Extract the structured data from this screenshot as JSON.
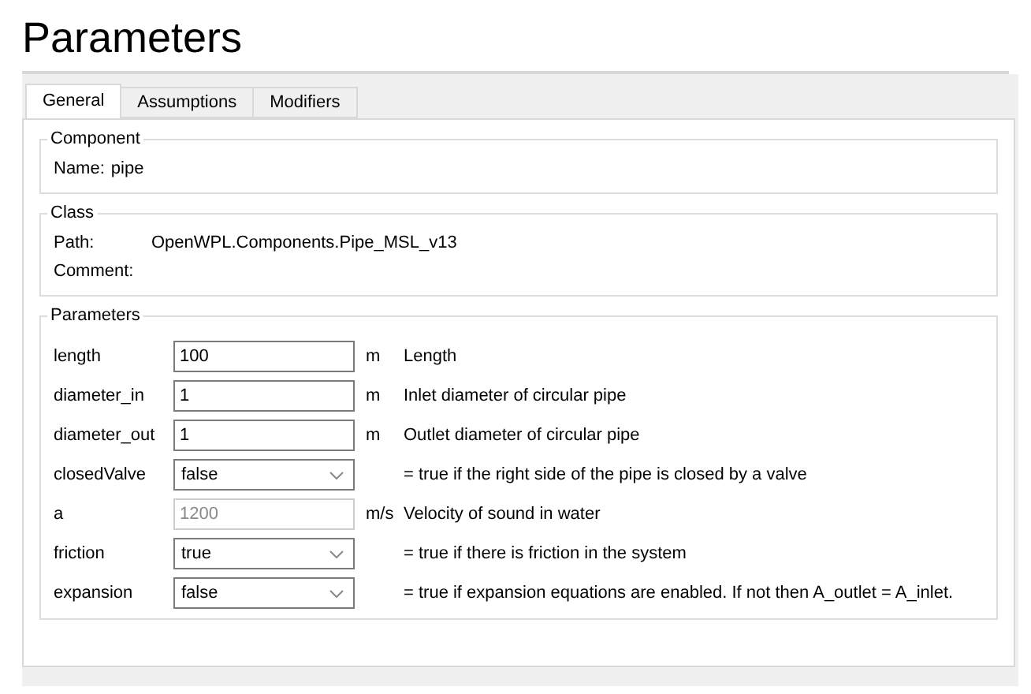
{
  "title": "Parameters",
  "tabs": [
    {
      "label": "General",
      "selected": true
    },
    {
      "label": "Assumptions",
      "selected": false
    },
    {
      "label": "Modifiers",
      "selected": false
    }
  ],
  "component": {
    "legend": "Component",
    "name_label": "Name:",
    "name_value": "pipe"
  },
  "class": {
    "legend": "Class",
    "path_label": "Path:",
    "path_value": "OpenWPL.Components.Pipe_MSL_v13",
    "comment_label": "Comment:"
  },
  "parameters": {
    "legend": "Parameters",
    "rows": [
      {
        "name": "length",
        "kind": "input",
        "value": "100",
        "unit": "m",
        "description": "Length"
      },
      {
        "name": "diameter_in",
        "kind": "input",
        "value": "1",
        "unit": "m",
        "description": "Inlet diameter of circular pipe"
      },
      {
        "name": "diameter_out",
        "kind": "input",
        "value": "1",
        "unit": "m",
        "description": "Outlet diameter of circular pipe"
      },
      {
        "name": "closedValve",
        "kind": "select",
        "value": "false",
        "description": "= true if the right side of the pipe is closed by a valve"
      },
      {
        "name": "a",
        "kind": "input",
        "value": "1200",
        "disabled": true,
        "unit": "m/s",
        "description": "Velocity of sound in water"
      },
      {
        "name": "friction",
        "kind": "select",
        "value": "true",
        "description": "= true if there is friction in the system"
      },
      {
        "name": "expansion",
        "kind": "select",
        "value": "false",
        "description": "= true if expansion equations are enabled. If not then A_outlet = A_inlet."
      }
    ]
  }
}
